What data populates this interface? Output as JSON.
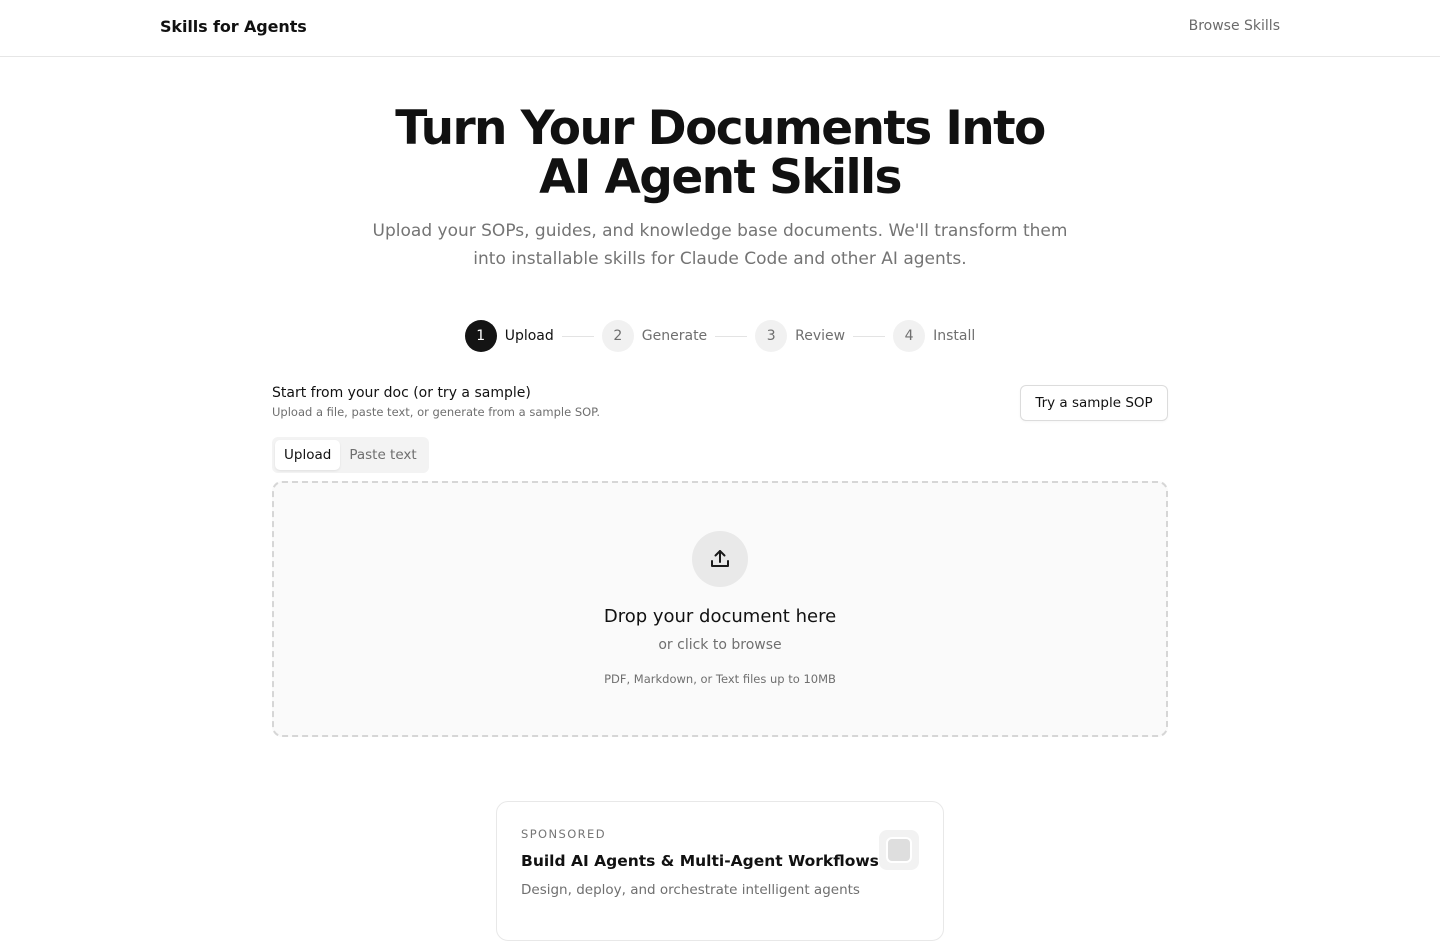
{
  "header": {
    "brand": "Skills for Agents",
    "nav_link": "Browse Skills"
  },
  "hero": {
    "title_line1": "Turn Your Documents Into",
    "title_line2": "AI Agent Skills",
    "subtitle": "Upload your SOPs, guides, and knowledge base documents. We'll transform them into installable skills for Claude Code and other AI agents."
  },
  "stepper": {
    "steps": [
      {
        "number": "1",
        "label": "Upload",
        "active": true
      },
      {
        "number": "2",
        "label": "Generate",
        "active": false
      },
      {
        "number": "3",
        "label": "Review",
        "active": false
      },
      {
        "number": "4",
        "label": "Install",
        "active": false
      }
    ]
  },
  "input_section": {
    "title": "Start from your doc (or try a sample)",
    "subtitle": "Upload a file, paste text, or generate from a sample SOP.",
    "sample_button": "Try a sample SOP",
    "tabs": [
      "Upload",
      "Paste text"
    ],
    "active_tab": "Upload"
  },
  "dropzone": {
    "icon": "upload-icon",
    "title": "Drop your document here",
    "subtitle": "or click to browse",
    "hint": "PDF, Markdown, or Text files up to 10MB"
  },
  "sponsor": {
    "tag": "SPONSORED",
    "title": "Build AI Agents & Multi-Agent Workflows",
    "description": "Design, deploy, and orchestrate intelligent agents",
    "logo_icon": "sponsor-logo-icon"
  },
  "colors": {
    "text_primary": "#111111",
    "text_muted": "#6f6f6f",
    "step_active_bg": "#141414",
    "border": "#e6e6e6",
    "dropzone_bg": "#fafafa"
  }
}
